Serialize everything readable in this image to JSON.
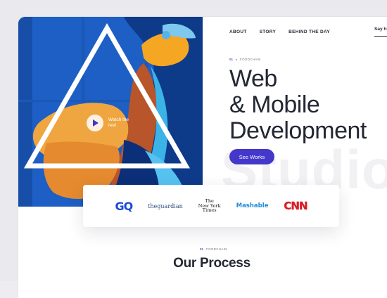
{
  "nav": {
    "items": [
      "ABOUT",
      "STORY",
      "BEHIND THE DAY"
    ],
    "right": "Say hi!"
  },
  "hero": {
    "crumb_number": "01",
    "crumb_label": "FOODCHAIN",
    "headline": [
      "Web",
      "& Mobile",
      "Development"
    ],
    "cta": "See Works",
    "watermark": "Studio",
    "watch_label": "Watch the reel"
  },
  "press_logos": {
    "gq": "GQ",
    "guardian": "theguardian",
    "nyt": [
      "The",
      "New York",
      "Times"
    ],
    "mashable": "Mashable",
    "cnn": "CNN"
  },
  "process": {
    "tag_number": "01",
    "tag_label": "FOODCHAIN",
    "title": "Our Process"
  },
  "colors": {
    "accent": "#4338ca",
    "hero_blue": "#1f63c8",
    "headline": "#232732"
  }
}
